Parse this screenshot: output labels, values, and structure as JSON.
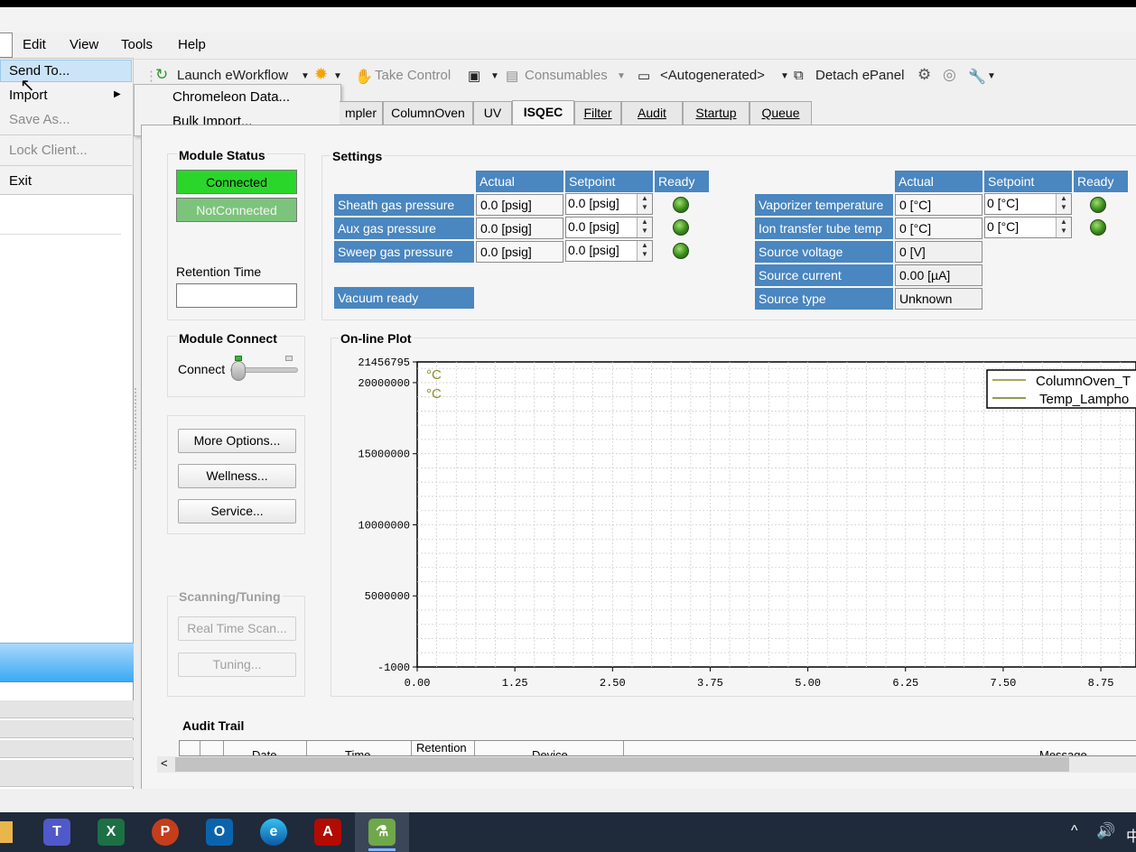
{
  "menubar": {
    "items": [
      "Edit",
      "View",
      "Tools",
      "Help"
    ]
  },
  "file_menu": {
    "items": [
      "Send To...",
      "Import",
      "Save As...",
      "Lock Client...",
      "Exit"
    ],
    "submenu": [
      "Chromeleon Data...",
      "Bulk Import..."
    ]
  },
  "toolbar": {
    "launch": "Launch eWorkflow",
    "take_control": "Take Control",
    "consumables": "Consumables",
    "autogenerated": "<Autogenerated>",
    "detach": "Detach ePanel"
  },
  "tabs": [
    "mpler",
    "ColumnOven",
    "UV",
    "ISQEC",
    "Filter",
    "Audit",
    "Startup",
    "Queue"
  ],
  "active_tab": "ISQEC",
  "module_status": {
    "title": "Module Status",
    "connected": "Connected",
    "not_connected": "NotConnected",
    "retention_label": "Retention Time",
    "retention_value": ""
  },
  "module_connect": {
    "title": "Module Connect",
    "label": "Connect"
  },
  "buttons": {
    "more": "More Options...",
    "wellness": "Wellness...",
    "service": "Service..."
  },
  "scanning": {
    "title": "Scanning/Tuning",
    "realtime": "Real Time Scan...",
    "tuning": "Tuning..."
  },
  "settings": {
    "title": "Settings",
    "headers": {
      "actual": "Actual",
      "setpoint": "Setpoint",
      "ready": "Ready"
    },
    "left_rows": [
      {
        "label": "Sheath gas pressure",
        "actual": "0.0 [psig]",
        "setpoint": "0.0 [psig]"
      },
      {
        "label": "Aux gas pressure",
        "actual": "0.0 [psig]",
        "setpoint": "0.0 [psig]"
      },
      {
        "label": "Sweep gas pressure",
        "actual": "0.0 [psig]",
        "setpoint": "0.0 [psig]"
      }
    ],
    "vacuum": "Vacuum ready",
    "right_rows": [
      {
        "label": "Vaporizer temperature",
        "actual": "0 [°C]",
        "setpoint": "0 [°C]"
      },
      {
        "label": "Ion transfer tube temp",
        "actual": "0 [°C]",
        "setpoint": "0 [°C]"
      },
      {
        "label": "Source voltage",
        "actual": "0 [V]"
      },
      {
        "label": "Source current",
        "actual": "0.00 [µA]"
      },
      {
        "label": "Source type",
        "actual": "Unknown"
      }
    ]
  },
  "plot": {
    "title": "On-line Plot",
    "units": [
      "°C",
      "°C"
    ]
  },
  "chart_data": {
    "type": "line",
    "xlim": [
      0,
      9.2
    ],
    "ylim": [
      -1000,
      21456795
    ],
    "x_ticks": [
      "0.00",
      "1.25",
      "2.50",
      "3.75",
      "5.00",
      "6.25",
      "7.50",
      "8.75"
    ],
    "x_tick_values": [
      0,
      1.25,
      2.5,
      3.75,
      5,
      6.25,
      7.5,
      8.75
    ],
    "y_ticks": [
      "21456795",
      "20000000",
      "15000000",
      "10000000",
      "5000000",
      "-1000"
    ],
    "y_tick_values": [
      21456795,
      20000000,
      15000000,
      10000000,
      5000000,
      -1000
    ],
    "grid": true,
    "legend_position": "top-right",
    "series": [
      {
        "name": "ColumnOven_T",
        "color": "#8b8b2a",
        "values": []
      },
      {
        "name": "Temp_Lampho",
        "color": "#6b7a1a",
        "values": []
      }
    ]
  },
  "audit": {
    "title": "Audit Trail",
    "columns": [
      "Date",
      "Time",
      "Retention",
      "Device",
      "Message"
    ]
  },
  "colors": {
    "connected": "#2bd62b",
    "notconnected": "#7cc47c",
    "header": "#4a86bf",
    "selection": "#3aaaf4"
  },
  "taskbar": {
    "icons": [
      "teams-icon",
      "excel-icon",
      "powerpoint-icon",
      "outlook-icon",
      "edge-icon",
      "acrobat-icon",
      "app-icon"
    ],
    "tray": "中"
  }
}
